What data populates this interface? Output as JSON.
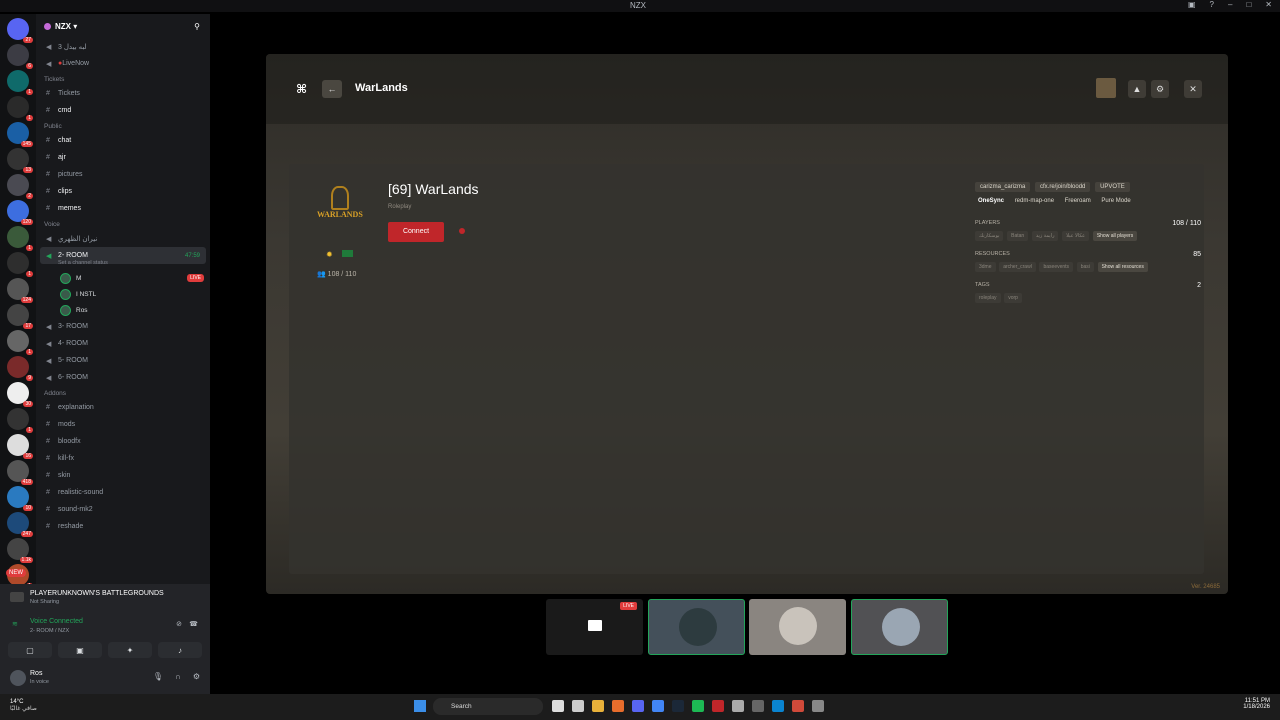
{
  "window": {
    "title": "NZX"
  },
  "server_rail": {
    "badges": [
      "27",
      "6",
      "1",
      "1",
      "145",
      "1",
      "13",
      "2",
      "120",
      "1",
      "1",
      "124",
      "17",
      "1",
      "9",
      "30",
      "1",
      "16",
      "418",
      "10",
      "247",
      "1.1k",
      "1"
    ],
    "new_label": "NEW"
  },
  "guild": {
    "name": "NZX"
  },
  "channels": {
    "top": [
      {
        "label": "3 لبه بيدل",
        "type": "voice"
      },
      {
        "label": "LiveNow",
        "type": "voice"
      }
    ],
    "cat_tickets": "Tickets",
    "tickets": [
      {
        "label": "Tickets"
      },
      {
        "label": "cmd"
      }
    ],
    "cat_public": "Public",
    "public": [
      {
        "label": "chat",
        "bold": true
      },
      {
        "label": "ajr",
        "bold": true
      },
      {
        "label": "pictures",
        "bold": false
      },
      {
        "label": "clips",
        "bold": true
      },
      {
        "label": "memes",
        "bold": true
      }
    ],
    "cat_voice": "Voice",
    "voice_top": "نيران الظهري",
    "active_room": {
      "label": "2- ROOM",
      "time": "47:59",
      "status": "Set a channel status"
    },
    "voice_users": [
      {
        "name": "M",
        "live": true
      },
      {
        "name": "I NSTL",
        "live": false
      },
      {
        "name": "Ros",
        "live": false
      }
    ],
    "live_label": "LIVE",
    "rooms": [
      "3- ROOM",
      "4- ROOM",
      "5- ROOM",
      "6- ROOM"
    ],
    "cat_addons": "Addons",
    "addons": [
      "explanation",
      "mods",
      "bloodfx",
      "kill-fx",
      "skin",
      "realistic-sound",
      "sound-mk2",
      "reshade"
    ]
  },
  "now_playing": {
    "game": "PLAYERUNKNOWN'S BATTLEGROUNDS",
    "status": "Not Sharing"
  },
  "voice": {
    "status": "Voice Connected",
    "channel": "2- ROOM / NZX"
  },
  "user": {
    "name": "Ros",
    "status": "In voice"
  },
  "game": {
    "title": "WarLands",
    "server_name": "[69] WarLands",
    "mode": "Roleplay",
    "connect_label": "Connect",
    "logo_text": "WARLANDS",
    "players_small": "108 / 110",
    "pills_top": [
      "carizma_carizma",
      "cfx.re/join/bloodd",
      "UPVOTE"
    ],
    "pills_meta": [
      "OneSync",
      "redm-map-one",
      "Freeroam",
      "Pure Mode"
    ],
    "players_label": "PLAYERS",
    "players_count": "108 / 110",
    "player_chips": [
      "بوسكارنك",
      "Batan",
      "رايمة زيد",
      "عكالا عبلا"
    ],
    "show_players": "Show all players",
    "resources_label": "RESOURCES",
    "resources_count": "85",
    "resource_chips": [
      "3dme",
      "archer_crawl",
      "baseevents",
      "basi"
    ],
    "show_resources": "Show all resources",
    "tags_label": "TAGS",
    "tags_count": "2",
    "tags": [
      "roleplay",
      "vorp"
    ],
    "version": "Ver. 24685"
  },
  "stream": {
    "live_label": "LIVE"
  },
  "taskbar": {
    "temp": "14°C",
    "weather_text": "صافي غالبًا",
    "search": "Search",
    "time": "11:51 PM",
    "date": "1/18/2026"
  }
}
